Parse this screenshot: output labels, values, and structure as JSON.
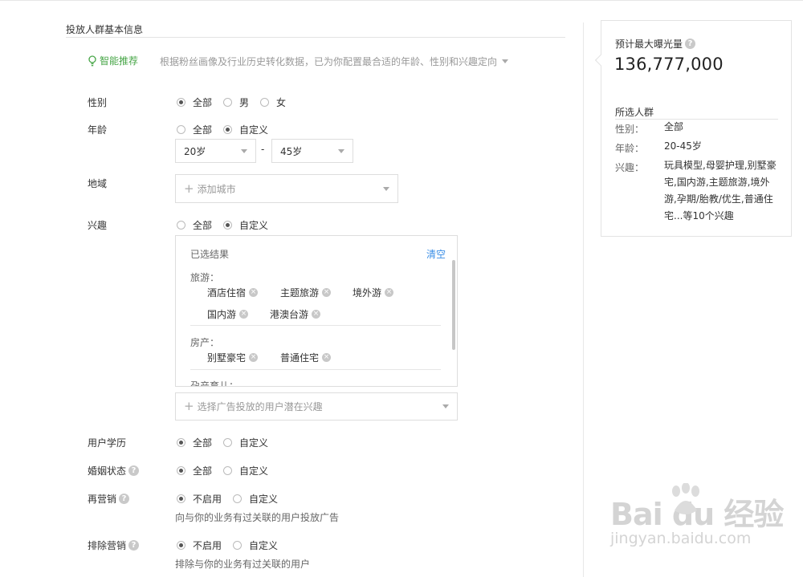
{
  "section_title": "投放人群基本信息",
  "smart": {
    "label": "智能推荐",
    "desc": "根据粉丝画像及行业历史转化数据，已为你配置最合适的年龄、性别和兴趣定向"
  },
  "gender": {
    "label": "性别",
    "options": [
      "全部",
      "男",
      "女"
    ],
    "selected": "全部"
  },
  "age": {
    "label": "年龄",
    "options": [
      "全部",
      "自定义"
    ],
    "selected": "自定义",
    "from": "20岁",
    "to": "45岁",
    "dash": "-"
  },
  "region": {
    "label": "地域",
    "placeholder": "添加城市"
  },
  "interest": {
    "label": "兴趣",
    "options": [
      "全部",
      "自定义"
    ],
    "selected": "自定义",
    "panel_title": "已选结果",
    "clear": "清空",
    "categories": [
      {
        "title": "旅游：",
        "tags": [
          "酒店住宿",
          "主题旅游",
          "境外游",
          "国内游",
          "港澳台游"
        ]
      },
      {
        "title": "房产：",
        "tags": [
          "别墅豪宅",
          "普通住宅"
        ]
      },
      {
        "title": "孕产育儿：",
        "tags": []
      }
    ],
    "add_placeholder": "选择广告投放的用户潜在兴趣"
  },
  "education": {
    "label": "用户学历",
    "options": [
      "全部",
      "自定义"
    ],
    "selected": "全部"
  },
  "marital": {
    "label": "婚姻状态",
    "options": [
      "全部",
      "自定义"
    ],
    "selected": "全部"
  },
  "remarketing": {
    "label": "再营销",
    "options": [
      "不启用",
      "自定义"
    ],
    "selected": "不启用",
    "hint": "向与你的业务有过关联的用户投放广告"
  },
  "exclude": {
    "label": "排除营销",
    "options": [
      "不启用",
      "自定义"
    ],
    "selected": "不启用",
    "hint": "排除与你的业务有过关联的用户"
  },
  "summary": {
    "exposure_label": "预计最大曝光量",
    "exposure_value": "136,777,000",
    "audience_title": "所选人群",
    "rows": [
      {
        "k": "性别：",
        "v": "全部"
      },
      {
        "k": "年龄：",
        "v": "20-45岁"
      },
      {
        "k": "兴趣：",
        "v": "玩具模型,母婴护理,别墅豪宅,国内游,主题旅游,境外游,孕期/胎教/优生,普通住宅...等10个兴趣"
      }
    ]
  },
  "watermark": {
    "logo": "Bai  du 经验",
    "sub": "jingyan.baidu.com"
  }
}
